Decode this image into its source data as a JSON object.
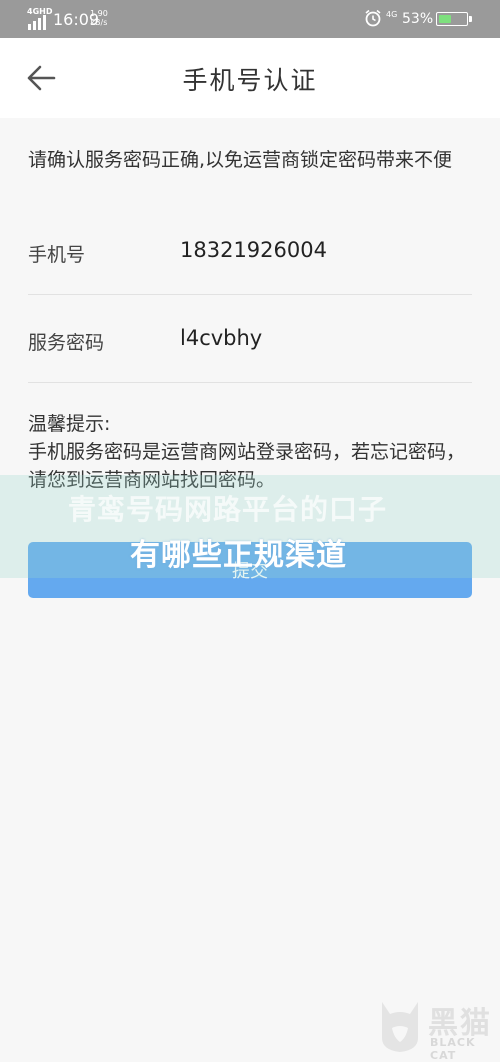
{
  "status_bar": {
    "network_type": "4G",
    "network_label": "HD",
    "time": "16:09",
    "speed_value": "1.90",
    "speed_unit": "kB/s",
    "network_type_right": "4G",
    "battery_percent": "53%",
    "battery_level": 0.53
  },
  "header": {
    "title": "手机号认证"
  },
  "form": {
    "notice": "请确认服务密码正确,以免运营商锁定密码带来不便",
    "phone_label": "手机号",
    "phone_value": "18321926004",
    "password_label": "服务密码",
    "password_value": "l4cvbhy"
  },
  "tips": {
    "heading": "温馨提示:",
    "body": "手机服务密码是运营商网站登录密码，若忘记密码，请您到运营商网站找回密码。"
  },
  "submit_label": "提交",
  "watermark": {
    "line1": "青鸾号码网路平台的口子",
    "line2": "有哪些正规渠道"
  },
  "logo": {
    "text_cn": "黑猫",
    "text_en": "BLACK CAT"
  }
}
